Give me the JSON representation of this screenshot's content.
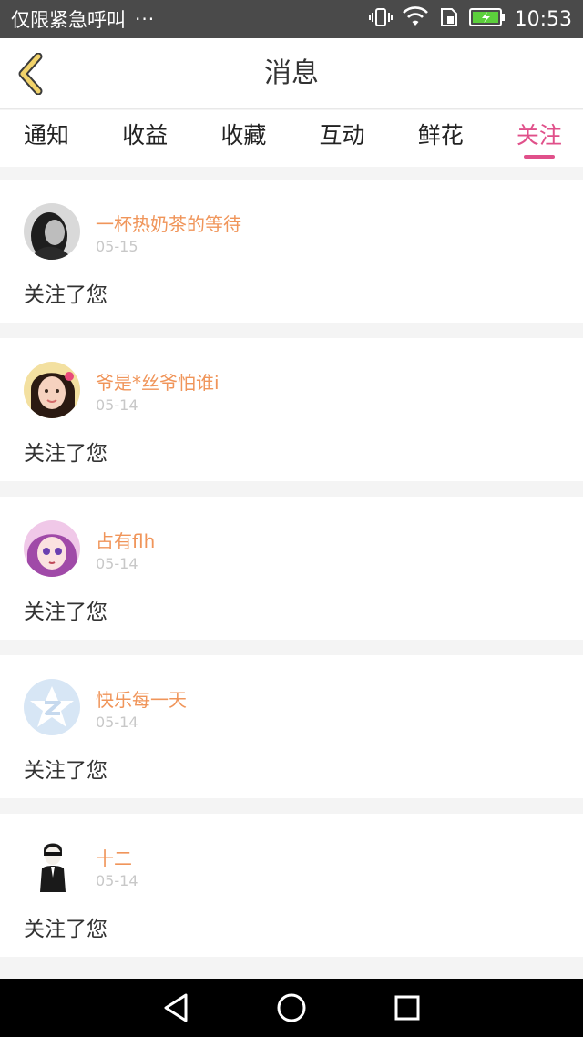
{
  "status_bar": {
    "left_text": "仅限紧急呼叫",
    "dots": "···",
    "time": "10:53",
    "icons": [
      "vibrate-icon",
      "wifi-icon",
      "sim-icon",
      "battery-charging-icon"
    ]
  },
  "header": {
    "title": "消息",
    "back_icon": "chevron-left-icon"
  },
  "tabs": [
    {
      "label": "通知",
      "active": false
    },
    {
      "label": "收益",
      "active": false
    },
    {
      "label": "收藏",
      "active": false
    },
    {
      "label": "互动",
      "active": false
    },
    {
      "label": "鲜花",
      "active": false
    },
    {
      "label": "关注",
      "active": true
    }
  ],
  "feed": [
    {
      "name": "一杯热奶茶的等待",
      "date": "05-15",
      "action": "关注了您"
    },
    {
      "name": "爷是*丝爷怕谁i",
      "date": "05-14",
      "action": "关注了您"
    },
    {
      "name": "占有flh",
      "date": "05-14",
      "action": "关注了您"
    },
    {
      "name": "快乐每一天",
      "date": "05-14",
      "action": "关注了您"
    },
    {
      "name": "十二",
      "date": "05-14",
      "action": "关注了您"
    }
  ],
  "nav_bar": {
    "icons": [
      "back-triangle-icon",
      "home-circle-icon",
      "recents-square-icon"
    ]
  },
  "colors": {
    "accent": "#e0508a",
    "username": "#f0955a",
    "back_chevron": "#f2d36a"
  }
}
